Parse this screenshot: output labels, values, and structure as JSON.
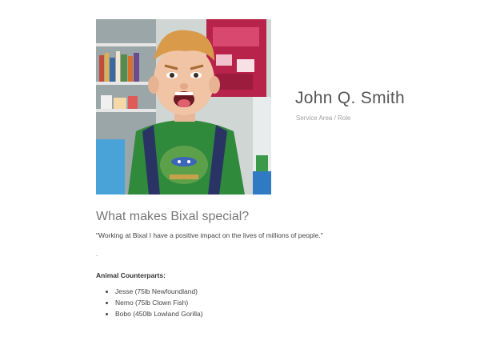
{
  "profile": {
    "name": "John Q. Smith",
    "role": "Service Area / Role",
    "photo": {
      "icon": "profile-photo"
    }
  },
  "content": {
    "heading": "What makes Bixal special?",
    "quote": "\"Working at Bixal I have a positive impact on the lives of millions of people.\"",
    "separator": ".",
    "counterparts_label": "Animal Counterparts:",
    "animals": [
      "Jesse (75lb Newfoundland)",
      "Nemo (75lb Clown Fish)",
      "Bobo (450lb Lowland Gorilla)"
    ]
  },
  "colors": {
    "background": "#ffffff",
    "heading": "#777777",
    "name": "#555555",
    "role": "#a0a0a0",
    "text": "#444444"
  }
}
